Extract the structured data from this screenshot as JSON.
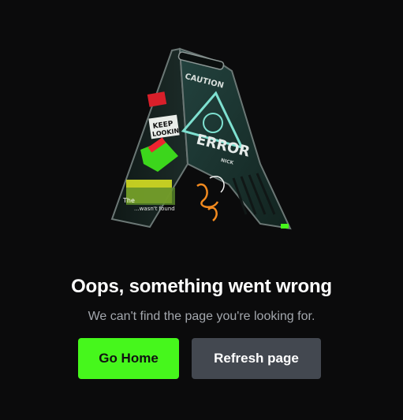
{
  "illustration": {
    "icon": "caution-sign-icon",
    "sign_header": "CAUTION",
    "sign_word": "ERROR",
    "sign_small": "NICK",
    "sticker_top": "KEEP",
    "sticker_bottom": "LOOKIN'",
    "graffiti_line1": "The ",
    "graffiti_line2": "...wasn't found"
  },
  "message": {
    "title": "Oops, something went wrong",
    "subtitle": "We can't find the page you're looking for."
  },
  "actions": {
    "home_label": "Go Home",
    "refresh_label": "Refresh page"
  },
  "colors": {
    "background": "#0b0b0c",
    "accent": "#46f71c",
    "secondary_button": "#434850",
    "subtitle_text": "#a3a7ad"
  }
}
